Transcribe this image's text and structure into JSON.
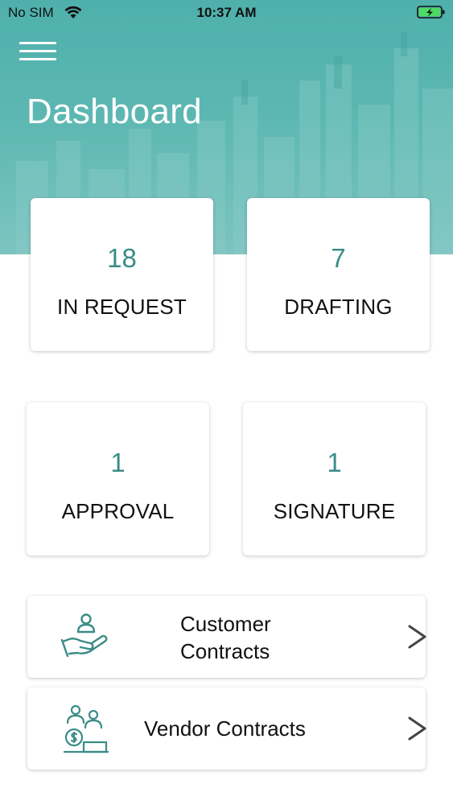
{
  "status_bar": {
    "carrier": "No SIM",
    "time": "10:37 AM"
  },
  "header": {
    "title": "Dashboard",
    "menu_icon": "hamburger-menu-icon"
  },
  "stats": [
    {
      "value": "18",
      "label": "IN REQUEST"
    },
    {
      "value": "7",
      "label": "DRAFTING"
    },
    {
      "value": "1",
      "label": "APPROVAL"
    },
    {
      "value": "1",
      "label": "SIGNATURE"
    }
  ],
  "links": [
    {
      "label_line1": "Customer",
      "label_line2": "Contracts",
      "icon": "hand-user-icon"
    },
    {
      "label": "Vendor Contracts",
      "icon": "vendor-meeting-icon"
    }
  ],
  "colors": {
    "accent": "#3a8c87",
    "header_teal": "#5cb7b2",
    "battery_green": "#4cd964"
  }
}
